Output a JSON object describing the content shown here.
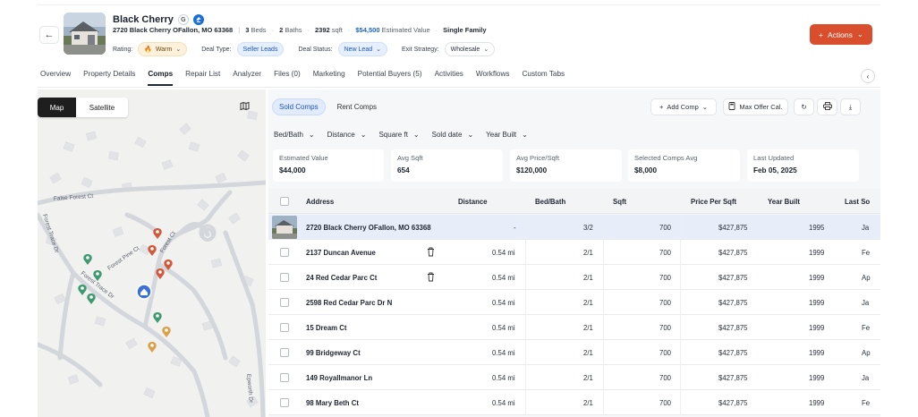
{
  "header": {
    "title": "Black Cherry",
    "google_badge": "G",
    "address": "2720 Black Cherry OFallon, MO 63368",
    "beds_num": "3",
    "beds_label": "Beds",
    "baths_num": "2",
    "baths_label": "Baths",
    "sqft_num": "2392",
    "sqft_label": "sqft",
    "est_value": "$54,500",
    "est_label": "Estimated Value",
    "property_type": "Single Family",
    "rating_label": "Rating:",
    "rating_value": "Warm",
    "deal_type_label": "Deal Type:",
    "deal_type_value": "Seller Leads",
    "deal_status_label": "Deal Status:",
    "deal_status_value": "New Lead",
    "exit_strategy_label": "Exit Strategy:",
    "exit_strategy_value": "Wholesale",
    "actions_label": "Actions",
    "actions_color": "#d94e2d"
  },
  "tabs": [
    {
      "label": "Overview"
    },
    {
      "label": "Property Details"
    },
    {
      "label": "Comps"
    },
    {
      "label": "Repair List"
    },
    {
      "label": "Analyzer"
    },
    {
      "label": "Files (0)"
    },
    {
      "label": "Marketing"
    },
    {
      "label": "Potential Buyers (5)"
    },
    {
      "label": "Activities"
    },
    {
      "label": "Workflows"
    },
    {
      "label": "Custom Tabs"
    }
  ],
  "active_tab": "Comps",
  "map": {
    "map_label": "Map",
    "satellite_label": "Satellite",
    "street_labels": [
      "False Forest Ct",
      "Forest Trace Dr",
      "Forest Pine Ct",
      "Forest Ct",
      "Forest Trace Dr",
      "Epworth Dr"
    ]
  },
  "comps": {
    "sold_label": "Sold Comps",
    "rent_label": "Rent Comps",
    "add_comp_label": "Add Comp",
    "max_offer_label": "Max Offer Cal.",
    "filters": [
      "Bed/Bath",
      "Distance",
      "Square ft",
      "Sold date",
      "Year Built"
    ],
    "stats": [
      {
        "label": "Estimated Value",
        "value": "$44,000"
      },
      {
        "label": "Avg Sqft",
        "value": "654"
      },
      {
        "label": "Avg Price/Sqft",
        "value": "$120,000"
      },
      {
        "label": "Selected Comps Avg",
        "value": "$8,000"
      },
      {
        "label": "Last Updated",
        "value": "Feb 05, 2025"
      }
    ],
    "columns": [
      "Address",
      "Distance",
      "Bed/Bath",
      "Sqft",
      "Price Per Sqft",
      "Year Built",
      "Last So"
    ],
    "rows": [
      {
        "address": "2720 Black Cherry OFallon, MO 63368",
        "distance": "-",
        "bedbath": "3/2",
        "sqft": "700",
        "ppsf": "$427,875",
        "year": "1995",
        "last": "Ja"
      },
      {
        "address": "2137 Duncan Avenue",
        "distance": "0.54 mi",
        "bedbath": "2/1",
        "sqft": "700",
        "ppsf": "$427,875",
        "year": "1999",
        "last": "Fe"
      },
      {
        "address": "24 Red Cedar Parc Ct",
        "distance": "0.54 mi",
        "bedbath": "2/1",
        "sqft": "700",
        "ppsf": "$427,875",
        "year": "1999",
        "last": "Ap"
      },
      {
        "address": "2598 Red Cedar Parc Dr N",
        "distance": "0.54 mi",
        "bedbath": "2/1",
        "sqft": "700",
        "ppsf": "$427,875",
        "year": "1999",
        "last": "Ja"
      },
      {
        "address": "15 Dream Ct",
        "distance": "0.54 mi",
        "bedbath": "2/1",
        "sqft": "700",
        "ppsf": "$427,875",
        "year": "1999",
        "last": "Fe"
      },
      {
        "address": "99 Bridgeway Ct",
        "distance": "0.54 mi",
        "bedbath": "2/1",
        "sqft": "700",
        "ppsf": "$427,875",
        "year": "1999",
        "last": "Ap"
      },
      {
        "address": "149 Royallmanor Ln",
        "distance": "0.54 mi",
        "bedbath": "2/1",
        "sqft": "700",
        "ppsf": "$427,875",
        "year": "1999",
        "last": "Ja"
      },
      {
        "address": "98 Mary Beth Ct",
        "distance": "0.54 mi",
        "bedbath": "2/1",
        "sqft": "700",
        "ppsf": "$427,875",
        "year": "1999",
        "last": "Fe"
      }
    ]
  }
}
